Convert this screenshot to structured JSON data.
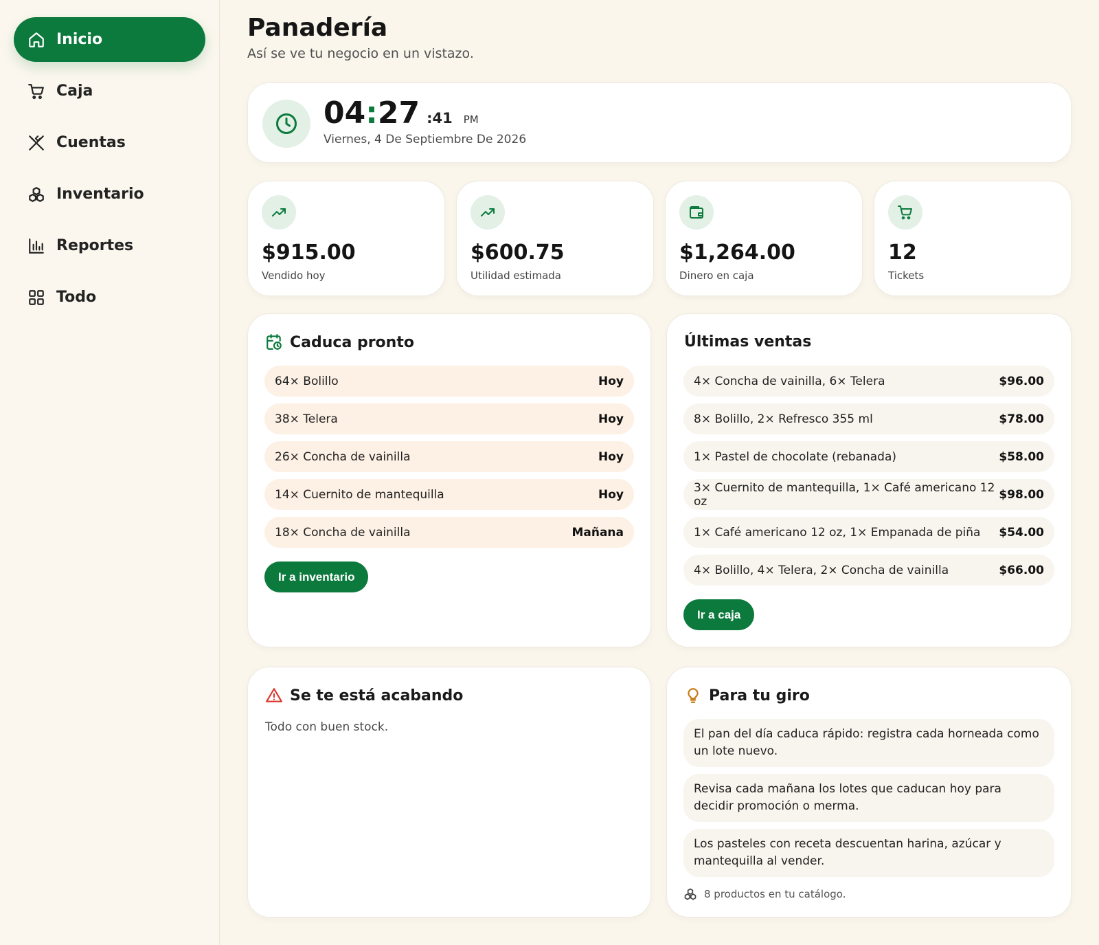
{
  "colors": {
    "accent": "#0c7a3d",
    "warn_row": "#fdf0e4",
    "neutral_row": "#f8f5ee",
    "alert_icon": "#d9362b",
    "bulb_icon": "#c87a12"
  },
  "sidebar": {
    "items": [
      {
        "label": "Inicio",
        "icon": "home-icon",
        "active": true
      },
      {
        "label": "Caja",
        "icon": "cart-icon"
      },
      {
        "label": "Cuentas",
        "icon": "utensils-icon"
      },
      {
        "label": "Inventario",
        "icon": "boxes-icon"
      },
      {
        "label": "Reportes",
        "icon": "bar-chart-icon"
      },
      {
        "label": "Todo",
        "icon": "grid-icon"
      }
    ]
  },
  "header": {
    "title": "Panadería",
    "subtitle": "Así se ve tu negocio en un vistazo."
  },
  "clock": {
    "hours": "04",
    "colon": ":",
    "minutes": "27",
    "seconds": ":41",
    "ampm": "PM",
    "date": "Viernes, 4 De Septiembre De 2026"
  },
  "stats": [
    {
      "value": "$915.00",
      "label": "Vendido hoy",
      "icon": "trending-up-icon"
    },
    {
      "value": "$600.75",
      "label": "Utilidad estimada",
      "icon": "trending-up-icon"
    },
    {
      "value": "$1,264.00",
      "label": "Dinero en caja",
      "icon": "wallet-icon"
    },
    {
      "value": "12",
      "label": "Tickets",
      "icon": "cart-icon"
    }
  ],
  "expiring": {
    "title": "Caduca pronto",
    "rows": [
      {
        "item": "64× Bolillo",
        "when": "Hoy"
      },
      {
        "item": "38× Telera",
        "when": "Hoy"
      },
      {
        "item": "26× Concha de vainilla",
        "when": "Hoy"
      },
      {
        "item": "14× Cuernito de mantequilla",
        "when": "Hoy"
      },
      {
        "item": "18× Concha de vainilla",
        "when": "Mañana"
      }
    ],
    "button": "Ir a inventario"
  },
  "sales": {
    "title": "Últimas ventas",
    "rows": [
      {
        "items": "4× Concha de vainilla, 6× Telera",
        "total": "$96.00"
      },
      {
        "items": "8× Bolillo, 2× Refresco 355 ml",
        "total": "$78.00"
      },
      {
        "items": "1× Pastel de chocolate (rebanada)",
        "total": "$58.00"
      },
      {
        "items": "3× Cuernito de mantequilla, 1× Café americano 12 oz",
        "total": "$98.00"
      },
      {
        "items": "1× Café americano 12 oz, 1× Empanada de piña",
        "total": "$54.00"
      },
      {
        "items": "4× Bolillo, 4× Telera, 2× Concha de vainilla",
        "total": "$66.00"
      }
    ],
    "button": "Ir a caja"
  },
  "low_stock": {
    "title": "Se te está acabando",
    "message": "Todo con buen stock."
  },
  "tips": {
    "title": "Para tu giro",
    "items": [
      "El pan del día caduca rápido: registra cada horneada como un lote nuevo.",
      "Revisa cada mañana los lotes que caducan hoy para decidir promoción o merma.",
      "Los pasteles con receta descuentan harina, azúcar y mantequilla al vender."
    ],
    "footnote": "8 productos en tu catálogo."
  }
}
